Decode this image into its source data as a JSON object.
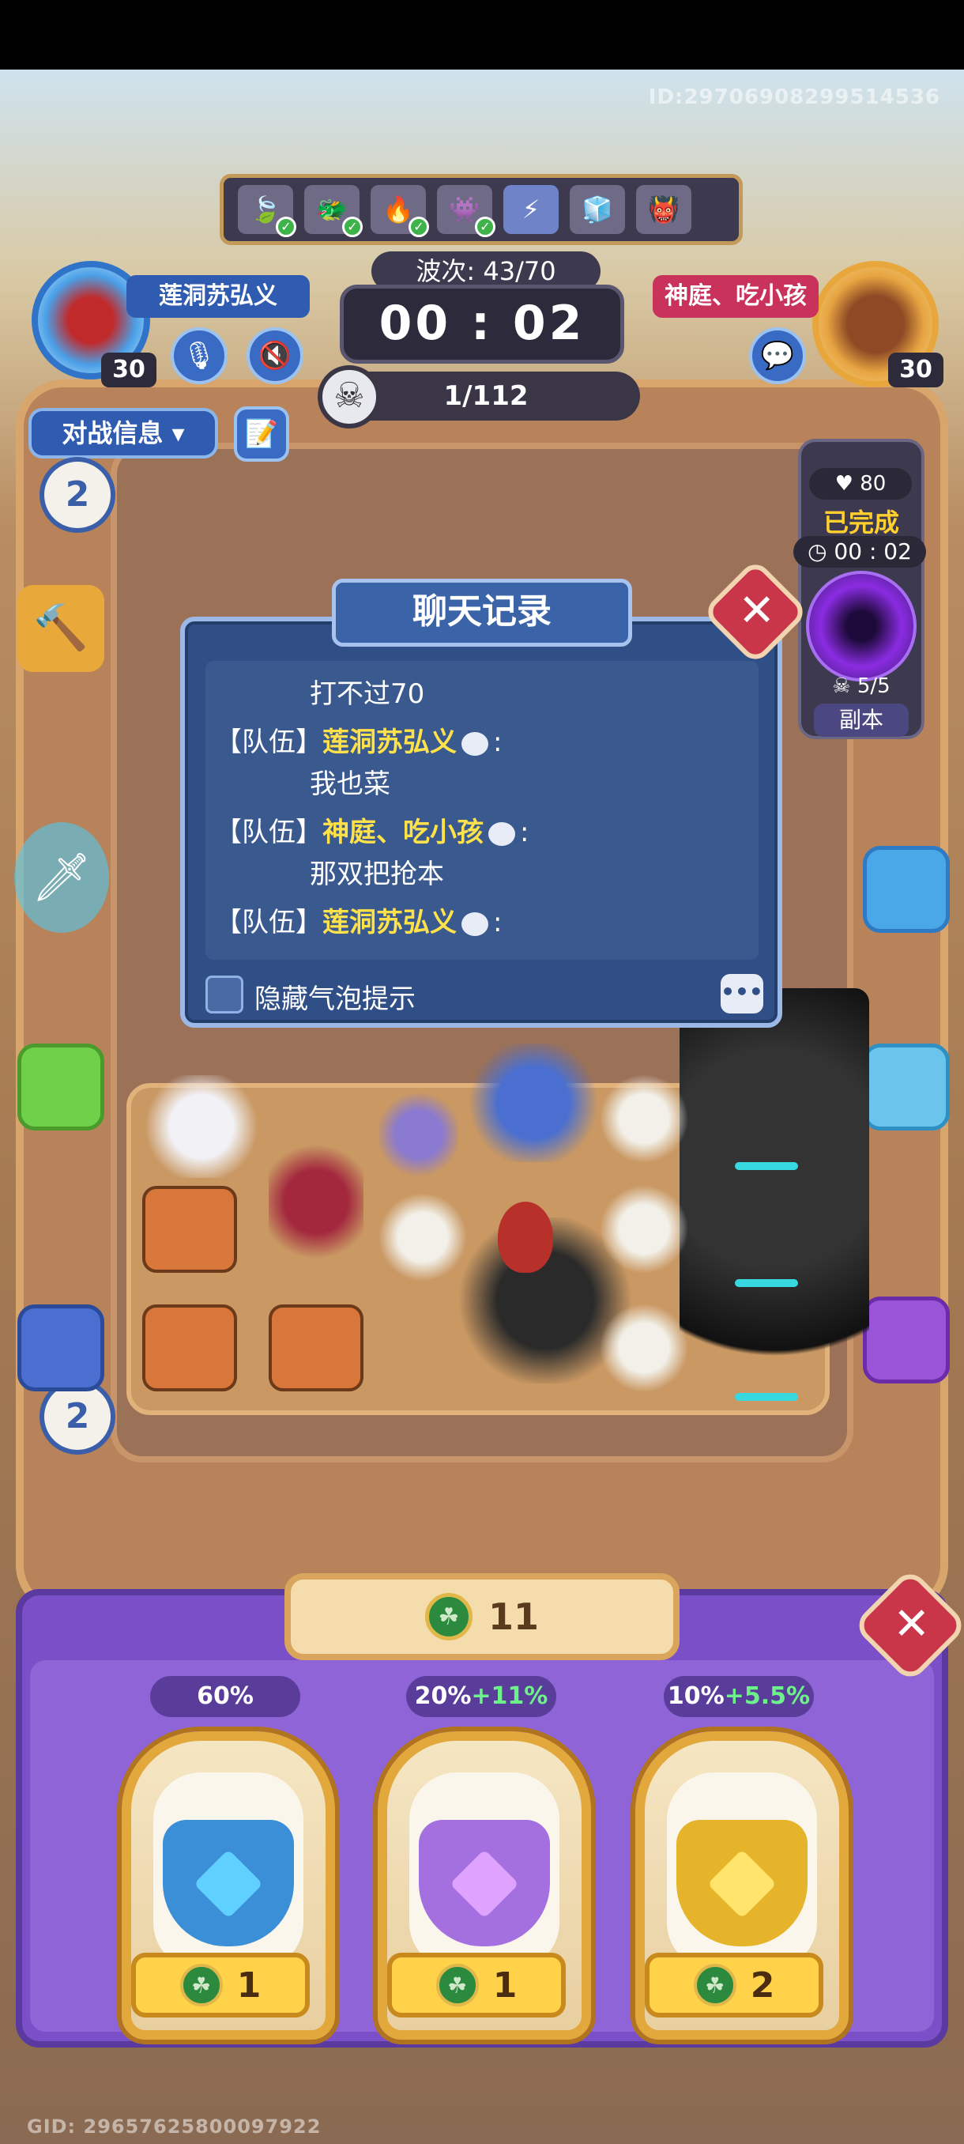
{
  "top": {
    "id_text": "ID:29706908299514536",
    "gid_text": "GID: 29657625800097922"
  },
  "waves": {
    "icons": [
      {
        "name": "leaf-icon",
        "glyph": "🍃",
        "done": true
      },
      {
        "name": "dark-knight-icon",
        "glyph": "🐲",
        "done": true
      },
      {
        "name": "fire-icon",
        "glyph": "🔥",
        "done": true
      },
      {
        "name": "monster-group-icon",
        "glyph": "👾",
        "done": true
      },
      {
        "name": "lightning-icon",
        "glyph": "⚡",
        "done": false,
        "active": true
      },
      {
        "name": "ice-monster-icon",
        "glyph": "🧊",
        "done": false
      },
      {
        "name": "boss-group-icon",
        "glyph": "👹",
        "done": false
      }
    ],
    "label": "波次: 43/70",
    "timer": "00 : 02",
    "kills": "1/112"
  },
  "players": {
    "left": {
      "name": "莲洞苏弘义",
      "level": "30"
    },
    "right": {
      "name": "神庭、吃小孩",
      "level": "30"
    }
  },
  "left_panel": {
    "battle_info_label": "对战信息 ▾",
    "bubble_top": "2",
    "bubble_bottom": "2"
  },
  "side_panel": {
    "hp": "♥ 80",
    "status": "已完成",
    "time": "◷ 00 : 02",
    "count": "☠ 5/5",
    "label": "副本"
  },
  "chat": {
    "title": "聊天记录",
    "messages": [
      {
        "channel": "",
        "name": "",
        "body": "打不过70"
      },
      {
        "channel": "【队伍】",
        "name": "莲洞苏弘义",
        "suffix": ":",
        "body": "我也菜"
      },
      {
        "channel": "【队伍】",
        "name": "神庭、吃小孩",
        "suffix": ":",
        "body": "那双把抢本"
      },
      {
        "channel": "【队伍】",
        "name": "莲洞苏弘义",
        "suffix": ":",
        "body": ""
      }
    ],
    "hide_bubble_label": "隐藏气泡提示"
  },
  "shop": {
    "coins": "11",
    "slots": [
      {
        "pct": "60%",
        "bonus": "",
        "price": "1",
        "color": "#3b8fd6",
        "gem": "#5fd0ff"
      },
      {
        "pct": "20%",
        "bonus": "+11%",
        "price": "1",
        "color": "#a470e0",
        "gem": "#e0a2ff"
      },
      {
        "pct": "10%",
        "bonus": "+5.5%",
        "price": "2",
        "color": "#e6b42a",
        "gem": "#ffe36a"
      }
    ]
  },
  "colors": {
    "accent_blue": "#2f5bb0",
    "accent_red": "#c8325b",
    "shop_purple": "#7a4fc7",
    "gold": "#e2a83c"
  }
}
